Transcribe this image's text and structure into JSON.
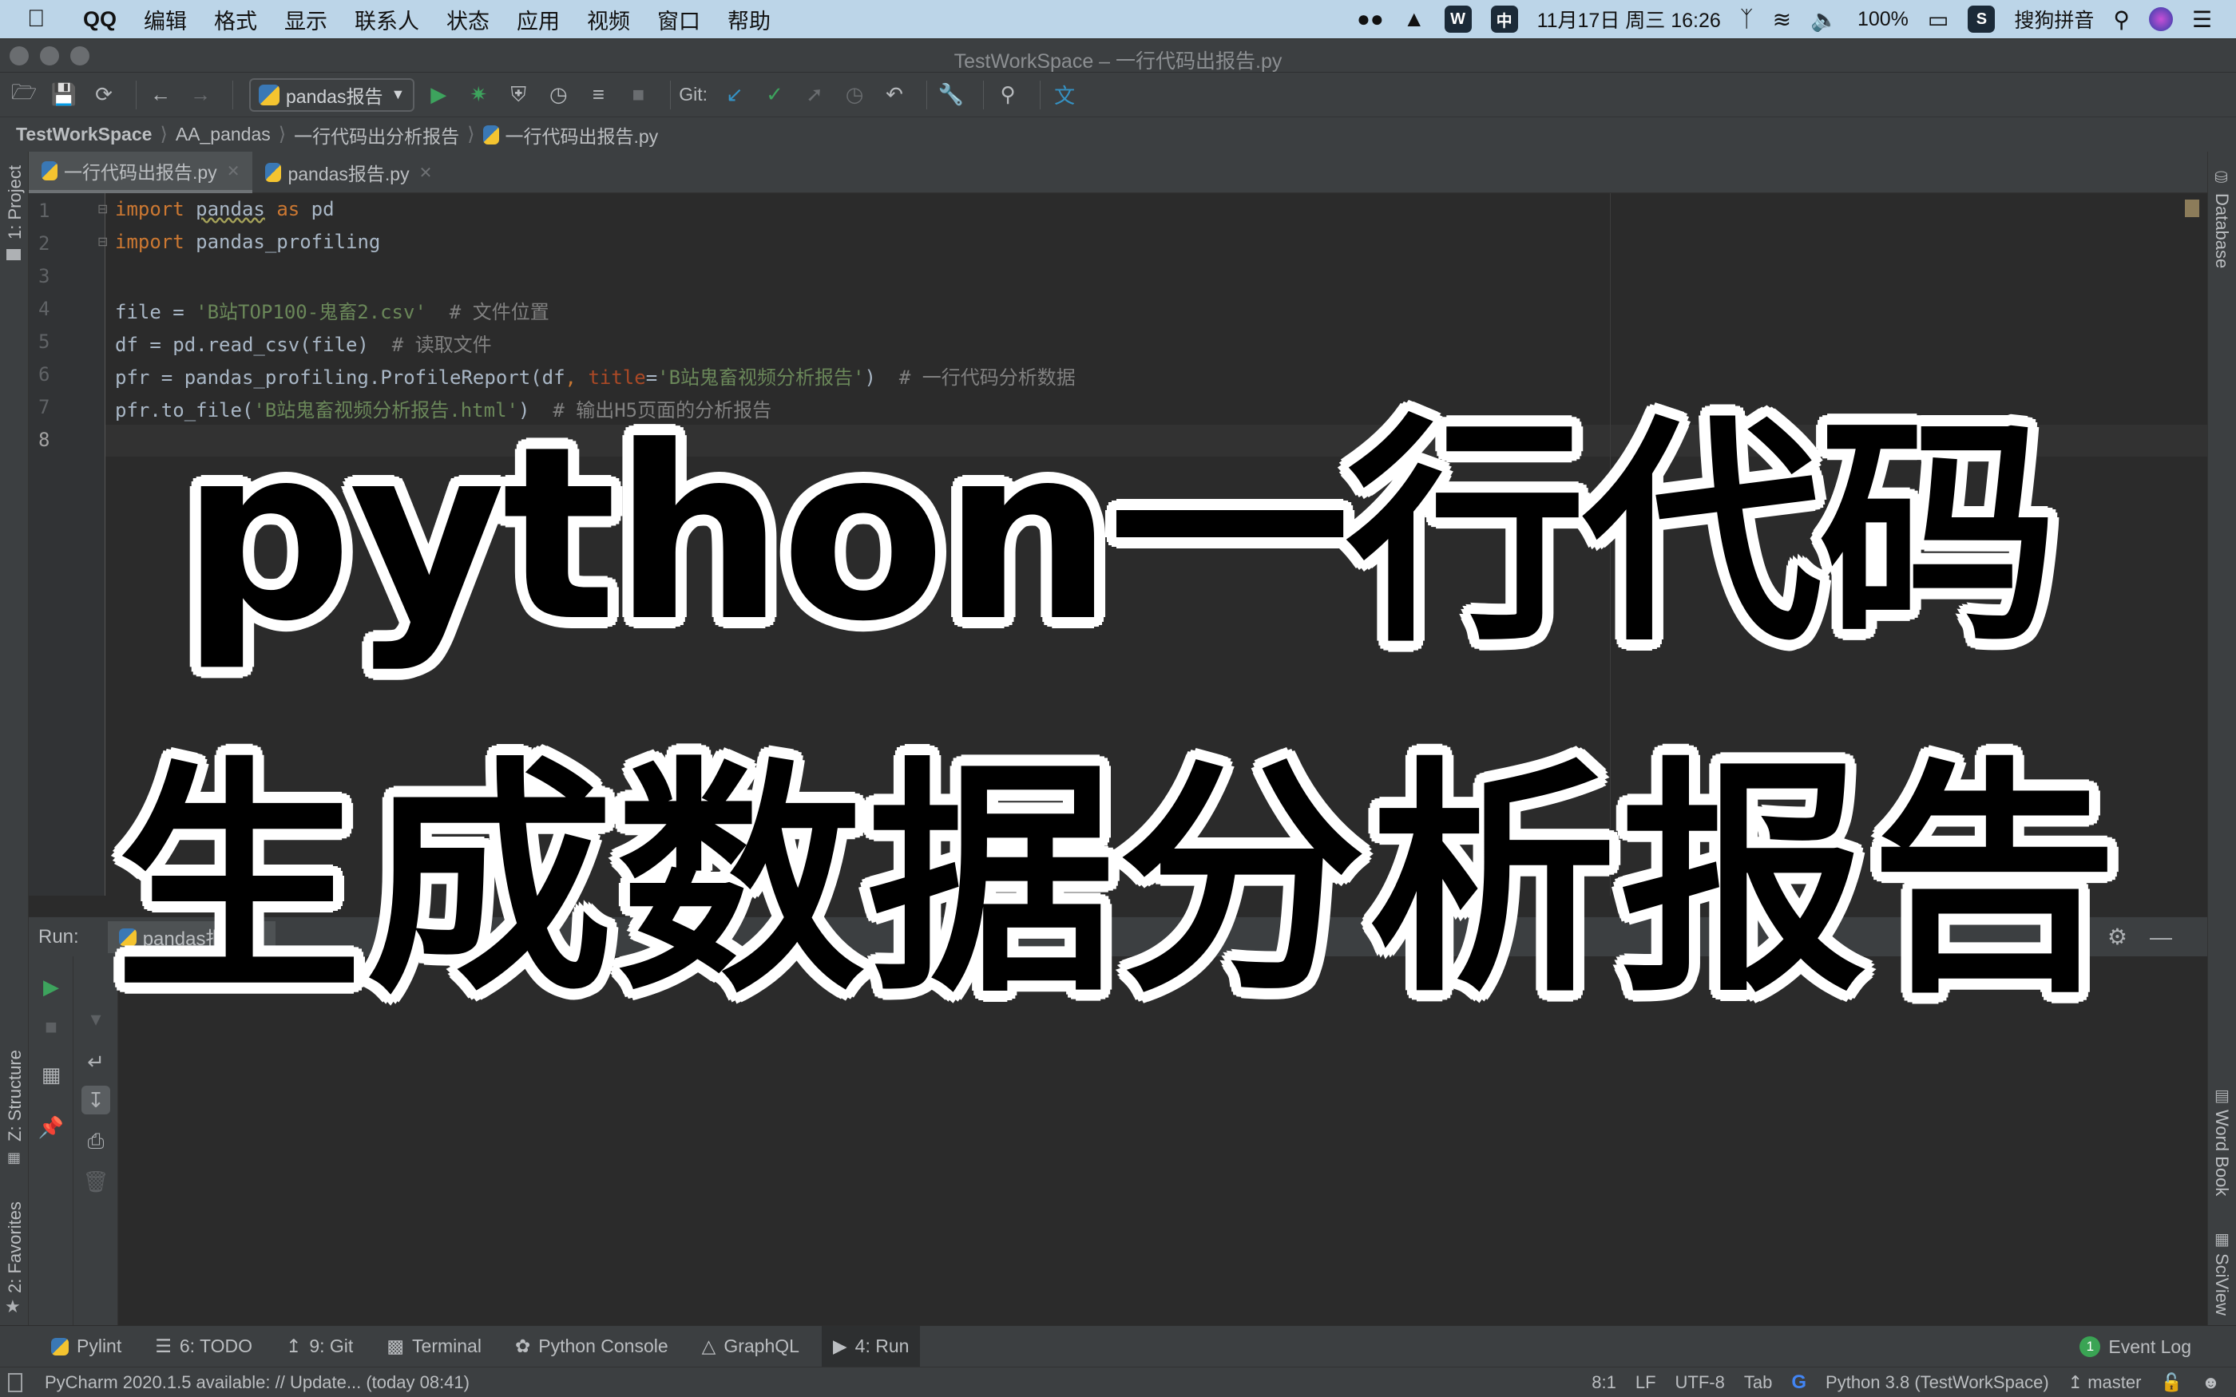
{
  "menubar": {
    "app": "QQ",
    "items": [
      "编辑",
      "格式",
      "显示",
      "联系人",
      "状态",
      "应用",
      "视频",
      "窗口",
      "帮助"
    ],
    "tray": {
      "wechat_icon": "wechat-icon",
      "qq_icon": "qq-penguin-icon",
      "wps_label": "W",
      "ime_label": "中",
      "datetime": "11月17日 周三 16:26",
      "battery": "100%",
      "sogou_label": "S",
      "ime_name": "搜狗拼音"
    }
  },
  "window": {
    "title": "TestWorkSpace – 一行代码出报告.py"
  },
  "toolbar": {
    "run_config": "pandas报告",
    "git_label": "Git:"
  },
  "breadcrumb": [
    "TestWorkSpace",
    "AA_pandas",
    "一行代码出分析报告",
    "一行代码出报告.py"
  ],
  "left_stripe": {
    "project": "1: Project",
    "structure": "Z: Structure",
    "favorites": "2: Favorites"
  },
  "right_stripe": {
    "database": "Database",
    "wordbook": "Word Book",
    "sciview": "SciView"
  },
  "tabs": [
    {
      "label": "一行代码出报告.py",
      "active": true
    },
    {
      "label": "pandas报告.py",
      "active": false
    }
  ],
  "code": {
    "line_numbers": [
      "1",
      "2",
      "3",
      "4",
      "5",
      "6",
      "7",
      "8"
    ],
    "l1": {
      "kw1": "import",
      "mod": "pandas",
      "kw2": "as",
      "alias": "pd"
    },
    "l2": {
      "kw": "import",
      "mod": "pandas_profiling"
    },
    "l4": {
      "code": "file = ",
      "str": "'B站TOP100-鬼畜2.csv'",
      "cmt": "  # 文件位置"
    },
    "l5": {
      "code": "df = pd.read_csv(file)",
      "cmt": "  # 读取文件"
    },
    "l6": {
      "code": "pfr = pandas_profiling.ProfileReport(df",
      "comma": ", ",
      "param": "title",
      "eq": "=",
      "str": "'B站鬼畜视频分析报告'",
      "close": ")",
      "cmt": "  # 一行代码分析数据"
    },
    "l7": {
      "code": "pfr.to_file(",
      "str": "'B站鬼畜视频分析报告.html'",
      "close": ")",
      "cmt": "  # 输出H5页面的分析报告"
    }
  },
  "run_panel": {
    "label": "Run:",
    "tab": "pandas报告"
  },
  "bottom_tools": [
    {
      "label": "Pylint",
      "icon": "python-icon"
    },
    {
      "label": "6: TODO",
      "icon": "list-icon"
    },
    {
      "label": "9: Git",
      "icon": "git-icon"
    },
    {
      "label": "Terminal",
      "icon": "terminal-icon"
    },
    {
      "label": "Python Console",
      "icon": "python-console-icon"
    },
    {
      "label": "GraphQL",
      "icon": "graphql-icon"
    },
    {
      "label": "4: Run",
      "icon": "run-icon",
      "active": true
    }
  ],
  "event_log": {
    "count": "1",
    "label": "Event Log"
  },
  "status": {
    "message": "PyCharm 2020.1.5 available: // Update... (today 08:41)",
    "position": "8:1",
    "line_sep": "LF",
    "encoding": "UTF-8",
    "indent": "Tab",
    "interpreter": "Python 3.8 (TestWorkSpace)",
    "branch": "master"
  },
  "overlay": {
    "line1": "python一行代码",
    "line2": "生成数据分析报告"
  }
}
